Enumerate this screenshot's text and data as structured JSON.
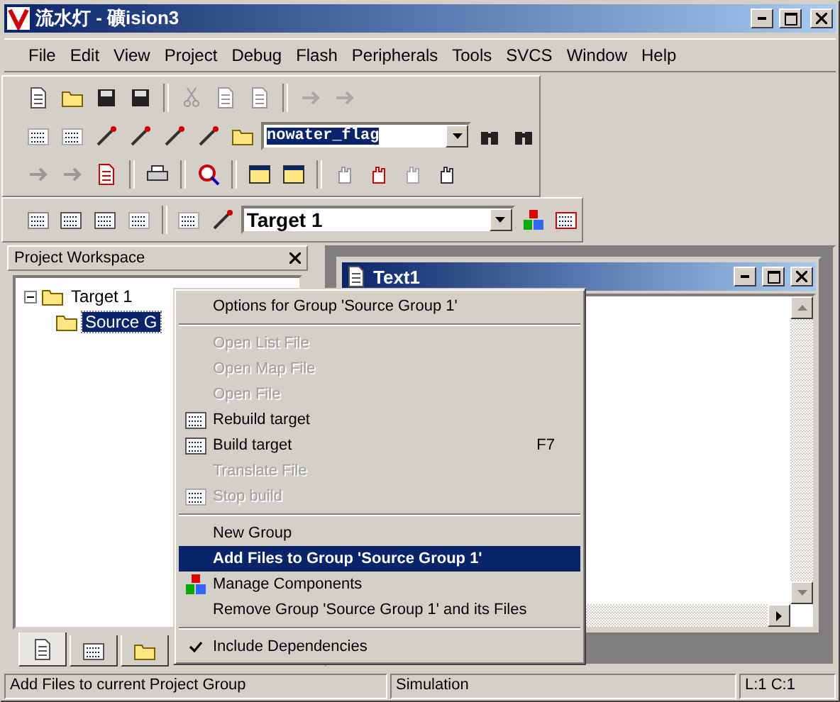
{
  "window": {
    "title": "流水灯  - 礦ision3"
  },
  "menu_bar": [
    "File",
    "Edit",
    "View",
    "Project",
    "Debug",
    "Flash",
    "Peripherals",
    "Tools",
    "SVCS",
    "Window",
    "Help"
  ],
  "find_combo": {
    "value": "nowater_flag"
  },
  "target_combo": {
    "value": "Target 1"
  },
  "workspace": {
    "title": "Project Workspace",
    "tree": [
      {
        "label": "Target 1",
        "expanded": true,
        "selected": false,
        "children": [
          {
            "label": "Source G",
            "selected": true
          }
        ]
      }
    ],
    "tabs": [
      {
        "selected": true
      },
      {
        "selected": false
      },
      {
        "selected": false
      }
    ]
  },
  "document": {
    "title": "Text1"
  },
  "context_menu": [
    {
      "kind": "item",
      "label": "Options for Group 'Source Group 1'",
      "disabled": false,
      "selected": false
    },
    {
      "kind": "separator"
    },
    {
      "kind": "item",
      "label": "Open List File",
      "disabled": true,
      "selected": false
    },
    {
      "kind": "item",
      "label": "Open Map File",
      "disabled": true,
      "selected": false
    },
    {
      "kind": "item",
      "label": "Open File",
      "disabled": true,
      "selected": false
    },
    {
      "kind": "rebuild",
      "label": "Rebuild target",
      "disabled": false,
      "selected": false
    },
    {
      "kind": "build",
      "label": "Build target",
      "disabled": false,
      "selected": false,
      "shortcut": "F7"
    },
    {
      "kind": "item",
      "label": "Translate File",
      "disabled": true,
      "selected": false
    },
    {
      "kind": "stop",
      "label": "Stop build",
      "disabled": true,
      "selected": false
    },
    {
      "kind": "separator"
    },
    {
      "kind": "item",
      "label": "New Group",
      "disabled": false,
      "selected": false
    },
    {
      "kind": "item",
      "label": "Add Files to Group 'Source Group 1'",
      "disabled": false,
      "selected": true
    },
    {
      "kind": "components",
      "label": "Manage Components",
      "disabled": false,
      "selected": false
    },
    {
      "kind": "item",
      "label": "Remove Group 'Source Group 1' and its Files",
      "disabled": false,
      "selected": false
    },
    {
      "kind": "separator"
    },
    {
      "kind": "item",
      "label": "Include Dependencies",
      "disabled": false,
      "selected": false,
      "checked": true
    }
  ],
  "status_bar": {
    "message": "Add Files to current Project Group",
    "mode": "Simulation",
    "position": "L:1 C:1"
  }
}
